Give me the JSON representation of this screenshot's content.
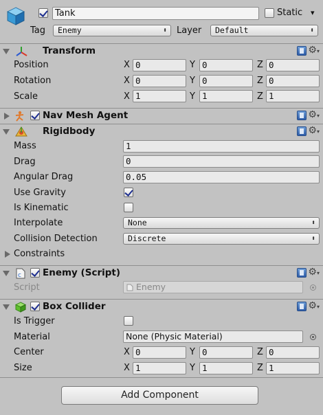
{
  "header": {
    "name_value": "Tank",
    "static_label": "Static",
    "static_arrow": "▾",
    "tag_label": "Tag",
    "tag_value": "Enemy",
    "layer_label": "Layer",
    "layer_value": "Default",
    "popup_arrow": "⬍"
  },
  "transform": {
    "title": "Transform",
    "rows": [
      {
        "label": "Position",
        "x": "0",
        "y": "0",
        "z": "0"
      },
      {
        "label": "Rotation",
        "x": "0",
        "y": "0",
        "z": "0"
      },
      {
        "label": "Scale",
        "x": "1",
        "y": "1",
        "z": "1"
      }
    ],
    "axis_x": "X",
    "axis_y": "Y",
    "axis_z": "Z"
  },
  "nav_mesh_agent": {
    "title": "Nav Mesh Agent"
  },
  "rigidbody": {
    "title": "Rigidbody",
    "mass_label": "Mass",
    "mass_value": "1",
    "drag_label": "Drag",
    "drag_value": "0",
    "angular_drag_label": "Angular Drag",
    "angular_drag_value": "0.05",
    "use_gravity_label": "Use Gravity",
    "use_gravity": true,
    "is_kinematic_label": "Is Kinematic",
    "is_kinematic": false,
    "interpolate_label": "Interpolate",
    "interpolate_value": "None",
    "collision_detection_label": "Collision Detection",
    "collision_detection_value": "Discrete",
    "constraints_label": "Constraints"
  },
  "enemy_script": {
    "title": "Enemy (Script)",
    "script_label": "Script",
    "script_value": "Enemy"
  },
  "box_collider": {
    "title": "Box Collider",
    "is_trigger_label": "Is Trigger",
    "is_trigger": false,
    "material_label": "Material",
    "material_value": "None (Physic Material)",
    "center_label": "Center",
    "center": {
      "x": "0",
      "y": "0",
      "z": "0"
    },
    "size_label": "Size",
    "size": {
      "x": "1",
      "y": "1",
      "z": "1"
    }
  },
  "add_component_label": "Add Component",
  "icons": {
    "gear": "⚙",
    "gear_caret": "▾"
  }
}
